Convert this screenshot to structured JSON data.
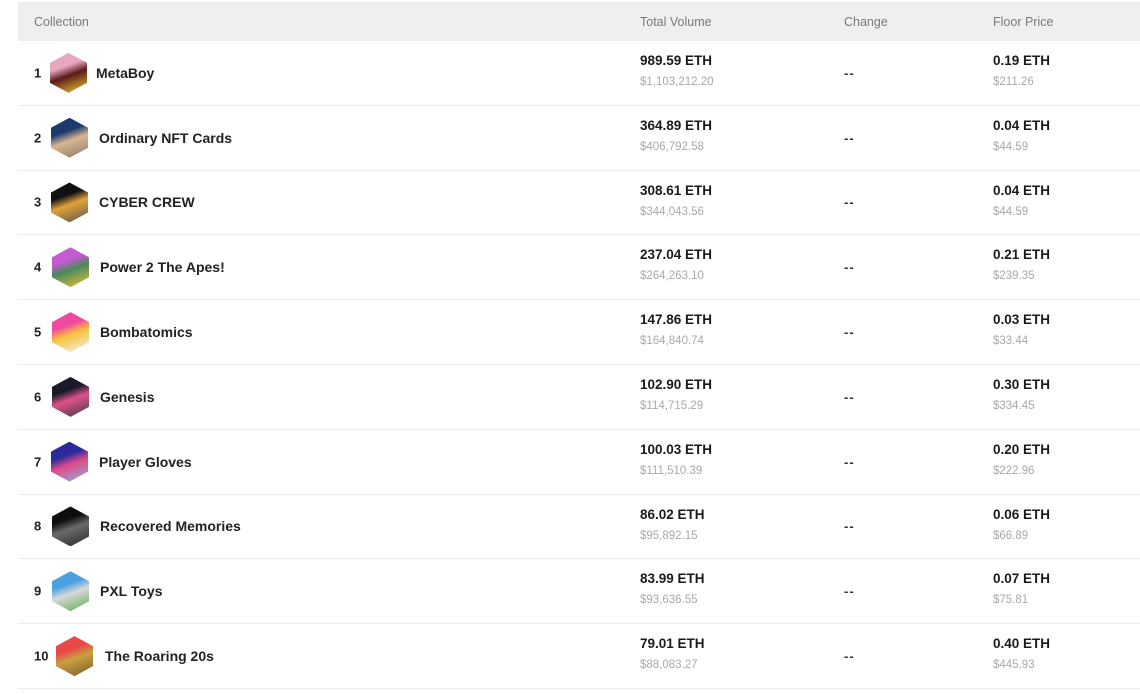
{
  "header": {
    "collection": "Collection",
    "total_volume": "Total Volume",
    "change": "Change",
    "floor_price": "Floor Price"
  },
  "rows": [
    {
      "rank": "1",
      "name": "MetaBoy",
      "icon": "metaboy-avatar-icon",
      "colors": [
        "#e8a6c0",
        "#5a1a1a",
        "#f2d02a"
      ],
      "volume_eth": "989.59 ETH",
      "volume_usd": "$1,103,212.20",
      "change": "--",
      "floor_eth": "0.19 ETH",
      "floor_usd": "$211.26"
    },
    {
      "rank": "2",
      "name": "Ordinary NFT Cards",
      "icon": "ordinary-nft-cards-avatar-icon",
      "colors": [
        "#1c3a6e",
        "#d9b48f",
        "#8a7a6a"
      ],
      "volume_eth": "364.89 ETH",
      "volume_usd": "$406,792.58",
      "change": "--",
      "floor_eth": "0.04 ETH",
      "floor_usd": "$44.59"
    },
    {
      "rank": "3",
      "name": "CYBER CREW",
      "icon": "cyber-crew-avatar-icon",
      "colors": [
        "#111111",
        "#e3a23a",
        "#555555"
      ],
      "volume_eth": "308.61 ETH",
      "volume_usd": "$344,043.56",
      "change": "--",
      "floor_eth": "0.04 ETH",
      "floor_usd": "$44.59"
    },
    {
      "rank": "4",
      "name": "Power 2 The Apes!",
      "icon": "power-2-the-apes-avatar-icon",
      "colors": [
        "#c45bd0",
        "#4a8a5a",
        "#e8c23a"
      ],
      "volume_eth": "237.04 ETH",
      "volume_usd": "$264,263.10",
      "change": "--",
      "floor_eth": "0.21 ETH",
      "floor_usd": "$239.35"
    },
    {
      "rank": "5",
      "name": "Bombatomics",
      "icon": "bombatomics-avatar-icon",
      "colors": [
        "#f04aa0",
        "#f5c23a",
        "#f2f2f2"
      ],
      "volume_eth": "147.86 ETH",
      "volume_usd": "$164,840.74",
      "change": "--",
      "floor_eth": "0.03 ETH",
      "floor_usd": "$33.44"
    },
    {
      "rank": "6",
      "name": "Genesis",
      "icon": "genesis-avatar-icon",
      "colors": [
        "#1a1a2a",
        "#e0508a",
        "#3a3a4a"
      ],
      "volume_eth": "102.90 ETH",
      "volume_usd": "$114,715.29",
      "change": "--",
      "floor_eth": "0.30 ETH",
      "floor_usd": "$334.45"
    },
    {
      "rank": "7",
      "name": "Player Gloves",
      "icon": "player-gloves-avatar-icon",
      "colors": [
        "#2a2a9a",
        "#e04a8a",
        "#8ab4e0"
      ],
      "volume_eth": "100.03 ETH",
      "volume_usd": "$111,510.39",
      "change": "--",
      "floor_eth": "0.20 ETH",
      "floor_usd": "$222.96"
    },
    {
      "rank": "8",
      "name": "Recovered Memories",
      "icon": "recovered-memories-avatar-icon",
      "colors": [
        "#0e0e0e",
        "#6a6a6a",
        "#2a2a2a"
      ],
      "volume_eth": "86.02 ETH",
      "volume_usd": "$95,892.15",
      "change": "--",
      "floor_eth": "0.06 ETH",
      "floor_usd": "$66.89"
    },
    {
      "rank": "9",
      "name": "PXL Toys",
      "icon": "pxl-toys-avatar-icon",
      "colors": [
        "#4aa0e0",
        "#d8d8d8",
        "#5ab04a"
      ],
      "volume_eth": "83.99 ETH",
      "volume_usd": "$93,636.55",
      "change": "--",
      "floor_eth": "0.07 ETH",
      "floor_usd": "$75.81"
    },
    {
      "rank": "10",
      "name": "The Roaring 20s",
      "icon": "the-roaring-20s-avatar-icon",
      "colors": [
        "#e84a4a",
        "#c8a040",
        "#7a5a2a"
      ],
      "volume_eth": "79.01 ETH",
      "volume_usd": "$88,083.27",
      "change": "--",
      "floor_eth": "0.40 ETH",
      "floor_usd": "$445.93"
    }
  ]
}
